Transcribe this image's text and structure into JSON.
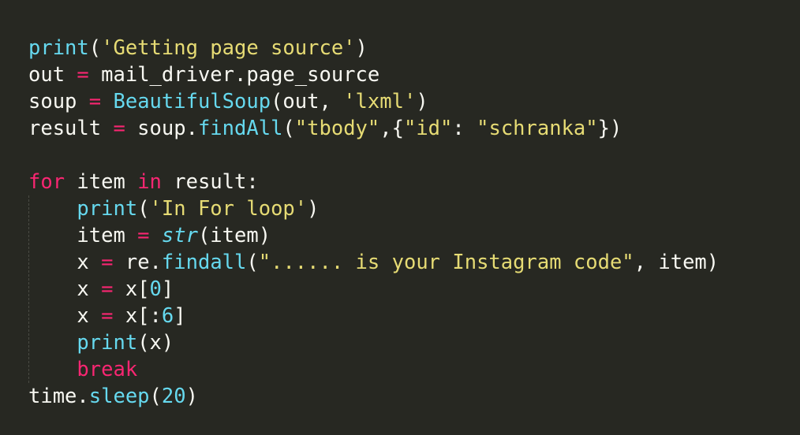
{
  "code": {
    "lines": [
      [
        {
          "text": "print",
          "kind": "fn"
        },
        {
          "text": "(",
          "kind": "plain"
        },
        {
          "text": "'Getting page source'",
          "kind": "str"
        },
        {
          "text": ")",
          "kind": "plain"
        }
      ],
      [
        {
          "text": "out ",
          "kind": "plain"
        },
        {
          "text": "=",
          "kind": "op"
        },
        {
          "text": " mail_driver.page_source",
          "kind": "plain"
        }
      ],
      [
        {
          "text": "soup ",
          "kind": "plain"
        },
        {
          "text": "=",
          "kind": "op"
        },
        {
          "text": " ",
          "kind": "plain"
        },
        {
          "text": "BeautifulSoup",
          "kind": "fn"
        },
        {
          "text": "(out, ",
          "kind": "plain"
        },
        {
          "text": "'lxml'",
          "kind": "str"
        },
        {
          "text": ")",
          "kind": "plain"
        }
      ],
      [
        {
          "text": "result ",
          "kind": "plain"
        },
        {
          "text": "=",
          "kind": "op"
        },
        {
          "text": " soup.",
          "kind": "plain"
        },
        {
          "text": "findAll",
          "kind": "fn"
        },
        {
          "text": "(",
          "kind": "plain"
        },
        {
          "text": "\"tbody\"",
          "kind": "str"
        },
        {
          "text": ",{",
          "kind": "plain"
        },
        {
          "text": "\"id\"",
          "kind": "str"
        },
        {
          "text": ": ",
          "kind": "plain"
        },
        {
          "text": "\"schranka\"",
          "kind": "str"
        },
        {
          "text": "})",
          "kind": "plain"
        }
      ],
      [],
      [
        {
          "text": "for",
          "kind": "kw"
        },
        {
          "text": " item ",
          "kind": "plain"
        },
        {
          "text": "in",
          "kind": "kw"
        },
        {
          "text": " result:",
          "kind": "plain"
        }
      ],
      [
        {
          "text": "    ",
          "kind": "plain"
        },
        {
          "text": "print",
          "kind": "fn"
        },
        {
          "text": "(",
          "kind": "plain"
        },
        {
          "text": "'In For loop'",
          "kind": "str"
        },
        {
          "text": ")",
          "kind": "plain"
        }
      ],
      [
        {
          "text": "    item ",
          "kind": "plain"
        },
        {
          "text": "=",
          "kind": "op"
        },
        {
          "text": " ",
          "kind": "plain"
        },
        {
          "text": "str",
          "kind": "builtin"
        },
        {
          "text": "(item)",
          "kind": "plain"
        }
      ],
      [
        {
          "text": "    x ",
          "kind": "plain"
        },
        {
          "text": "=",
          "kind": "op"
        },
        {
          "text": " re.",
          "kind": "plain"
        },
        {
          "text": "findall",
          "kind": "fn"
        },
        {
          "text": "(",
          "kind": "plain"
        },
        {
          "text": "\"...... is your Instagram code\"",
          "kind": "str"
        },
        {
          "text": ", item)",
          "kind": "plain"
        }
      ],
      [
        {
          "text": "    x ",
          "kind": "plain"
        },
        {
          "text": "=",
          "kind": "op"
        },
        {
          "text": " x[",
          "kind": "plain"
        },
        {
          "text": "0",
          "kind": "num"
        },
        {
          "text": "]",
          "kind": "plain"
        }
      ],
      [
        {
          "text": "    x ",
          "kind": "plain"
        },
        {
          "text": "=",
          "kind": "op"
        },
        {
          "text": " x[:",
          "kind": "plain"
        },
        {
          "text": "6",
          "kind": "num"
        },
        {
          "text": "]",
          "kind": "plain"
        }
      ],
      [
        {
          "text": "    ",
          "kind": "plain"
        },
        {
          "text": "print",
          "kind": "fn"
        },
        {
          "text": "(x)",
          "kind": "plain"
        }
      ],
      [
        {
          "text": "    ",
          "kind": "plain"
        },
        {
          "text": "break",
          "kind": "kw"
        }
      ],
      [
        {
          "text": "time.",
          "kind": "plain"
        },
        {
          "text": "sleep",
          "kind": "fn"
        },
        {
          "text": "(",
          "kind": "plain"
        },
        {
          "text": "20",
          "kind": "num"
        },
        {
          "text": ")",
          "kind": "plain"
        }
      ]
    ]
  },
  "colors": {
    "background": "#272822",
    "plain": "#f8f8f2",
    "function": "#66d9ef",
    "string": "#e6db74",
    "keyword": "#f92672",
    "number": "#66d9ef"
  }
}
